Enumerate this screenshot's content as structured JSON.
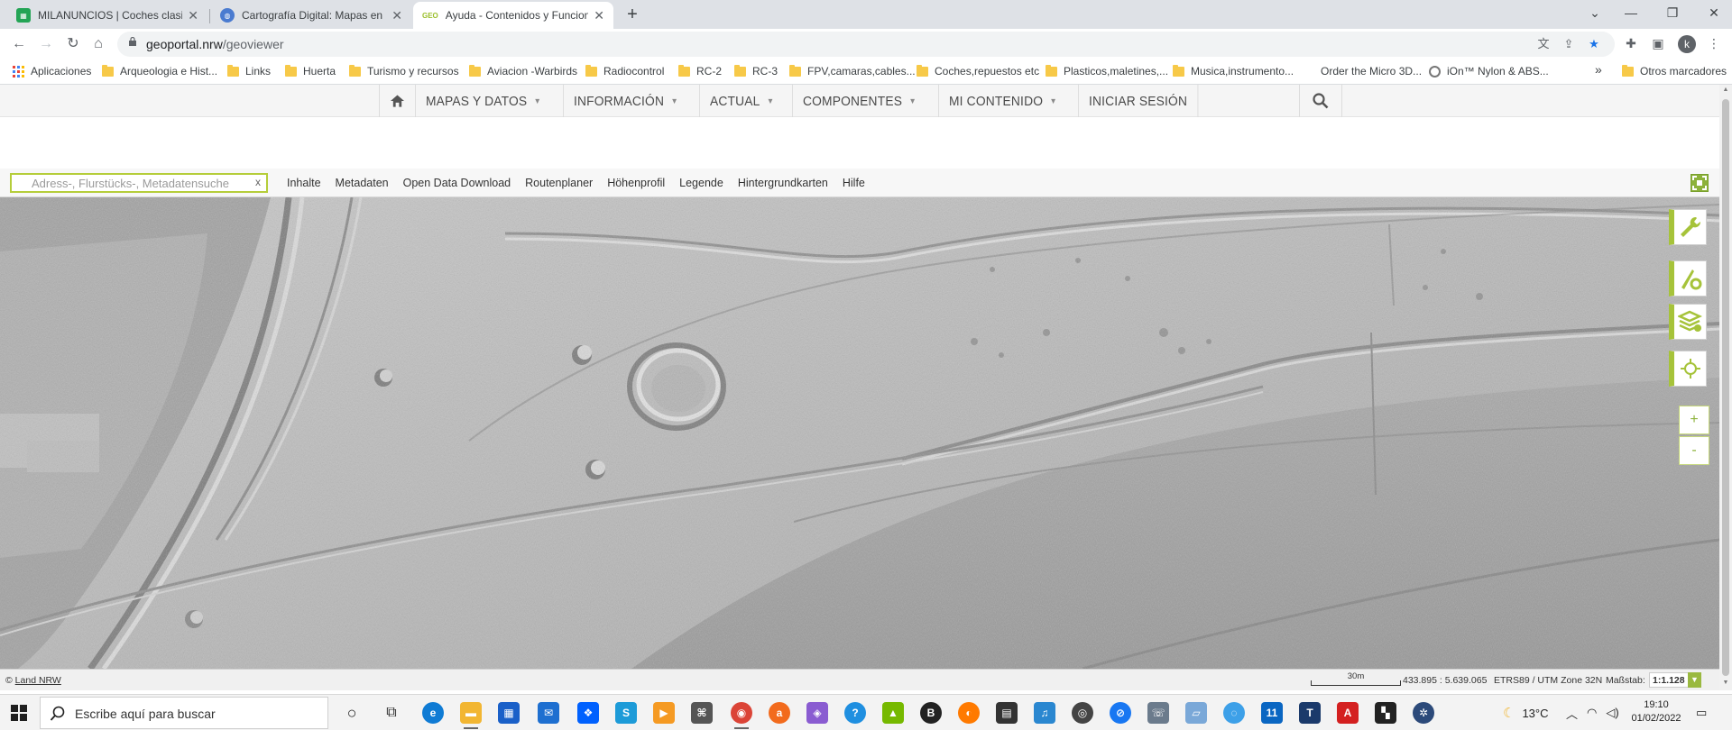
{
  "browser": {
    "tabs": [
      {
        "title": "MILANUNCIOS | Coches clasicos"
      },
      {
        "title": "Cartografía Digital: Mapas en Rel"
      },
      {
        "title": "Ayuda - Contenidos y Funciones"
      }
    ],
    "new_tab": "+",
    "url_host": "geoportal.nrw",
    "url_path": "/geoviewer",
    "profile_initial": "k"
  },
  "bookmarks": {
    "items": [
      "Aplicaciones",
      "Arqueologia e Hist...",
      "Links",
      "Huerta",
      "Turismo y recursos",
      "Aviacion -Warbirds",
      "Radiocontrol",
      "RC-2",
      "RC-3",
      "FPV,camaras,cables...",
      "Coches,repuestos etc",
      "Plasticos,maletines,...",
      "Musica,instrumento...",
      "Order the Micro 3D...",
      "iOn™ Nylon & ABS..."
    ],
    "more": "»",
    "other": "Otros marcadores"
  },
  "site_nav": {
    "items": [
      "MAPAS Y DATOS",
      "INFORMACIÓN",
      "ACTUAL",
      "COMPONENTES",
      "MI CONTENIDO",
      "INICIAR SESIÓN"
    ]
  },
  "geoviewer": {
    "search_placeholder": "Adress-, Flurstücks-, Metadatensuche",
    "search_clear": "x",
    "menu": [
      "Inhalte",
      "Metadaten",
      "Open Data Download",
      "Routenplaner",
      "Höhenprofil",
      "Legende",
      "Hintergrundkarten",
      "Hilfe"
    ],
    "side_tools": [
      "wrench-icon",
      "measure-tools-icon",
      "layer-settings-icon",
      "locate-icon"
    ],
    "zoom_in": "+",
    "zoom_out": "-"
  },
  "statusbar": {
    "copyright_symbol": "©",
    "copyright_link": "Land NRW",
    "scale_bar_label": "30m",
    "coordinates": "433.895 : 5.639.065",
    "crs": "ETRS89 / UTM Zone 32N",
    "scale_label": "Maßstab:",
    "scale_value": "1:1.128"
  },
  "taskbar": {
    "search_text": "Escribe aquí para buscar",
    "weather": "13°C",
    "time": "19:10",
    "date": "01/02/2022"
  },
  "colors": {
    "accent_green": "#a6c33a",
    "tab_bg": "#dee1e6",
    "star_blue": "#1a73e8"
  }
}
